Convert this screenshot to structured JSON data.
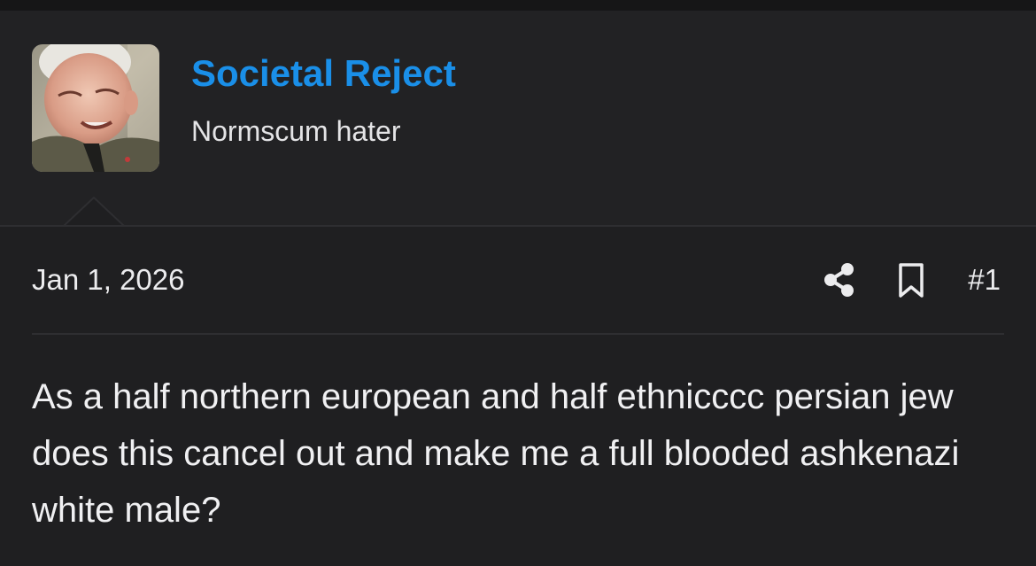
{
  "user": {
    "name": "Societal Reject",
    "title": "Normscum hater",
    "avatar_icon": "user-avatar-photo"
  },
  "post": {
    "date": "Jan 1, 2026",
    "number": "#1",
    "body": "As a half northern european and half ethnicccc persian jew does this cancel out and make me a full blooded ashkenazi white male?"
  },
  "icons": {
    "share": "share-icon",
    "bookmark": "bookmark-icon"
  },
  "colors": {
    "username": "#1a8fe8",
    "background": "#1f1f21",
    "text": "#f0f0f2"
  }
}
